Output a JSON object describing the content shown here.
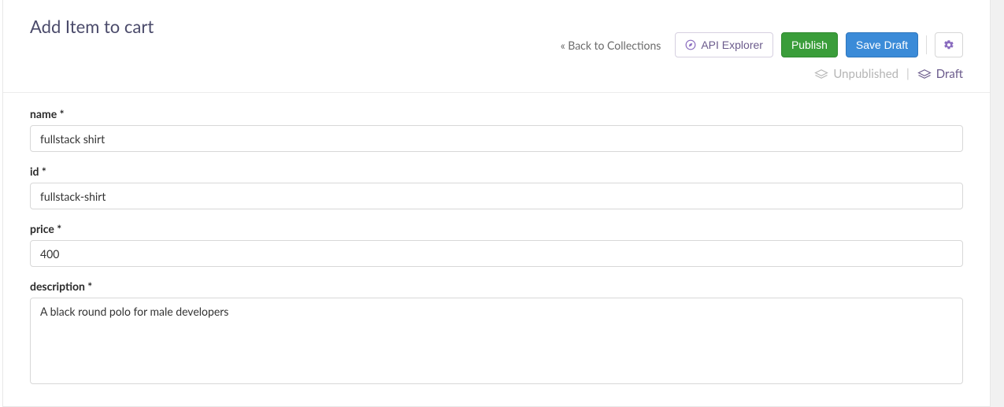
{
  "header": {
    "title": "Add Item to cart",
    "back_link": "« Back to Collections",
    "api_explorer": "API Explorer",
    "publish": "Publish",
    "save_draft": "Save Draft"
  },
  "status": {
    "unpublished": "Unpublished",
    "draft": "Draft"
  },
  "form": {
    "name": {
      "label": "name *",
      "value": "fullstack shirt"
    },
    "id": {
      "label": "id *",
      "value": "fullstack-shirt"
    },
    "price": {
      "label": "price *",
      "value": "400"
    },
    "description": {
      "label": "description *",
      "value": "A black round polo for male developers"
    }
  }
}
